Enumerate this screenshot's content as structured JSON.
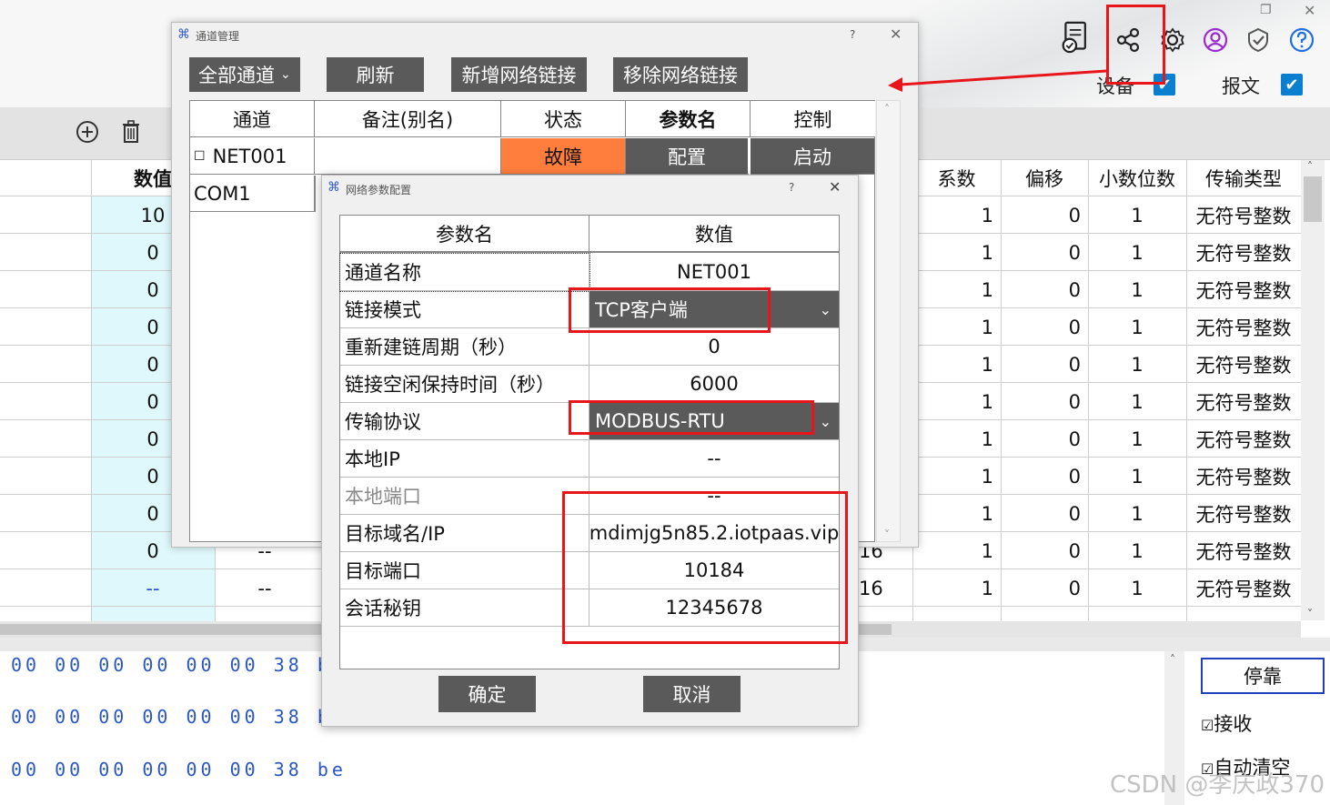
{
  "main": {
    "top_labels": {
      "device": "设备",
      "message": "报文"
    },
    "table": {
      "headers": [
        "数值",
        "系数",
        "偏移",
        "小数位数",
        "传输类型"
      ],
      "rows": [
        {
          "value": "10",
          "coef": "1",
          "offset": "0",
          "dec": "1",
          "type": "无符号整数"
        },
        {
          "value": "0",
          "coef": "1",
          "offset": "0",
          "dec": "1",
          "type": "无符号整数"
        },
        {
          "value": "0",
          "coef": "1",
          "offset": "0",
          "dec": "1",
          "type": "无符号整数"
        },
        {
          "value": "0",
          "coef": "1",
          "offset": "0",
          "dec": "1",
          "type": "无符号整数"
        },
        {
          "value": "0",
          "coef": "1",
          "offset": "0",
          "dec": "1",
          "type": "无符号整数"
        },
        {
          "value": "0",
          "coef": "1",
          "offset": "0",
          "dec": "1",
          "type": "无符号整数"
        },
        {
          "value": "0",
          "coef": "1",
          "offset": "0",
          "dec": "1",
          "type": "无符号整数"
        },
        {
          "value": "0",
          "coef": "1",
          "offset": "0",
          "dec": "1",
          "type": "无符号整数"
        },
        {
          "value": "0",
          "coef": "1",
          "offset": "0",
          "dec": "1",
          "type": "无符号整数"
        },
        {
          "value": "0",
          "col2": "--",
          "col3": "16",
          "coef": "1",
          "offset": "0",
          "dec": "1",
          "type": "无符号整数"
        },
        {
          "value": "--",
          "col2": "--",
          "col3": "16",
          "coef": "1",
          "offset": "0",
          "dec": "1",
          "type": "无符号整数"
        }
      ]
    },
    "hex_lines": [
      "00 00 00 00 00 00 38 be",
      "00 00 00 00 00 00 38 be",
      "00 00 00 00 00 00 38 be"
    ],
    "stop_button": "停靠",
    "side_checks": {
      "receive": "接收",
      "auto_clear": "自动清空"
    },
    "watermark": "CSDN @李庆政370"
  },
  "channel_dialog": {
    "title": "通道管理",
    "help": "?",
    "buttons": {
      "all_channels": "全部通道",
      "refresh": "刷新",
      "add_net": "新增网络链接",
      "remove_net": "移除网络链接"
    },
    "headers": [
      "通道",
      "备注(别名)",
      "状态",
      "参数名",
      "控制"
    ],
    "rows": [
      {
        "channel": "NET001",
        "note": "",
        "status": "故障",
        "param": "配置",
        "control": "启动"
      },
      {
        "channel": "COM1"
      }
    ]
  },
  "net_dialog": {
    "title": "网络参数配置",
    "help": "?",
    "headers": {
      "name": "参数名",
      "value": "数值"
    },
    "params": [
      {
        "name": "通道名称",
        "value": "NET001"
      },
      {
        "name": "链接模式",
        "value": "TCP客户端"
      },
      {
        "name": "重新建链周期（秒）",
        "value": "0"
      },
      {
        "name": "链接空闲保持时间（秒）",
        "value": "6000"
      },
      {
        "name": "传输协议",
        "value": "MODBUS-RTU"
      },
      {
        "name": "本地IP",
        "value": "--"
      },
      {
        "name": "本地端口",
        "value": "--"
      },
      {
        "name": "目标域名/IP",
        "value": "mdimjg5n85.2.iotpaas.vip"
      },
      {
        "name": "目标端口",
        "value": "10184"
      },
      {
        "name": "会话秘钥",
        "value": "12345678"
      }
    ],
    "ok": "确定",
    "cancel": "取消"
  },
  "colors": {
    "fault": "#ff7e3d",
    "dark_button": "#5a5a5a",
    "highlight_red": "#e8161b",
    "value_column": "#dff8fb",
    "hex_text": "#2a56c6"
  }
}
